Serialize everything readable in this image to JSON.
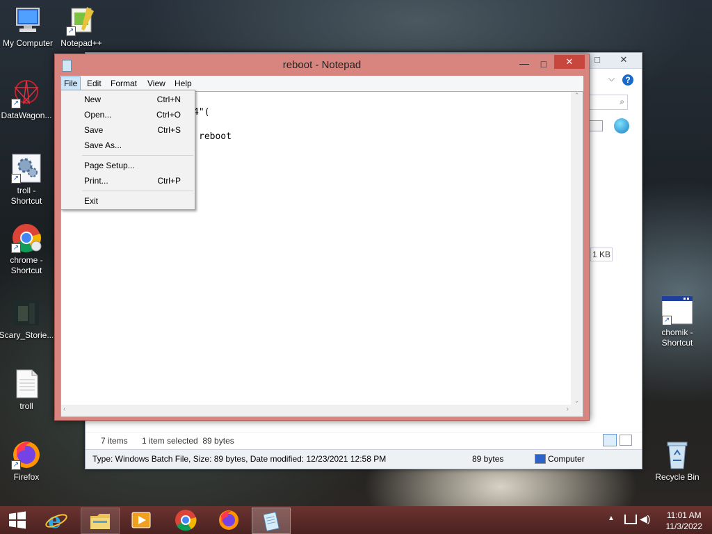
{
  "desktop": {
    "icons": [
      {
        "label": "My Computer"
      },
      {
        "label": "Notepad++"
      },
      {
        "label": "DataWagon..."
      },
      {
        "label": "troll -\nShortcut"
      },
      {
        "label": "chrome -\nShortcut"
      },
      {
        "label": "Scary_Storie..."
      },
      {
        "label": "troll"
      },
      {
        "label": "Firefox"
      },
      {
        "label": "chomik -\nShortcut"
      },
      {
        "label": "Recycle Bin"
      }
    ]
  },
  "explorer": {
    "items_count": "7 items",
    "selected": "1 item selected  89 bytes",
    "size_label": "1 KB",
    "details": "Type: Windows Batch File, Size: 89 bytes, Date modified: 12/23/2021 12:58 PM",
    "details_size": "89 bytes",
    "location": "Computer"
  },
  "notepad": {
    "title": "reboot - Notepad",
    "menu": [
      "File",
      "Edit",
      "Format",
      "View",
      "Help"
    ],
    "line1": "4\"(",
    "line2": "reboot",
    "file_menu": [
      {
        "label": "New",
        "shortcut": "Ctrl+N"
      },
      {
        "label": "Open...",
        "shortcut": "Ctrl+O"
      },
      {
        "label": "Save",
        "shortcut": "Ctrl+S"
      },
      {
        "label": "Save As...",
        "shortcut": ""
      },
      {
        "label": "Page Setup...",
        "shortcut": ""
      },
      {
        "label": "Print...",
        "shortcut": "Ctrl+P"
      },
      {
        "label": "Exit",
        "shortcut": ""
      }
    ]
  },
  "taskbar": {
    "time": "11:01 AM",
    "date": "11/3/2022"
  },
  "colors": {
    "notepad_frame": "#d8857f",
    "close_button": "#c7463d",
    "taskbar": "#5b2a28"
  }
}
